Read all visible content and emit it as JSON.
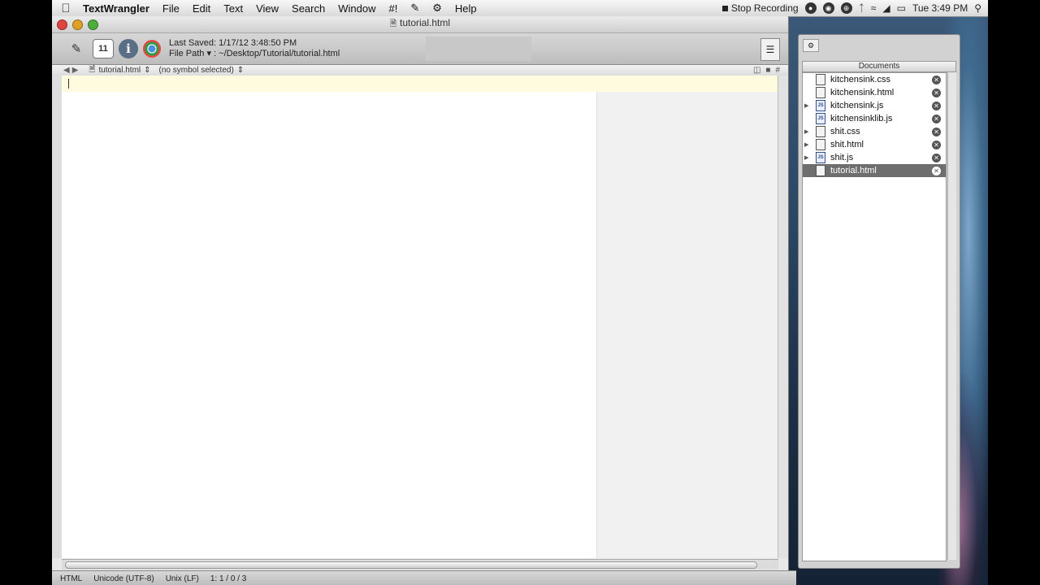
{
  "menubar": {
    "app_name": "TextWrangler",
    "items": [
      "File",
      "Edit",
      "Text",
      "View",
      "Search",
      "Window",
      "#!",
      "Help"
    ],
    "status_text": "Stop Recording",
    "clock": "Tue 3:49 PM"
  },
  "window": {
    "title": "tutorial.html",
    "toolbar": {
      "last_saved": "Last Saved: 1/17/12 3:48:50 PM",
      "file_path": "File Path ▾ : ~/Desktop/Tutorial/tutorial.html",
      "calendar_glyph": "11"
    },
    "navbar": {
      "file": "tutorial.html",
      "symbol": "(no symbol selected)"
    },
    "status": {
      "language": "HTML",
      "encoding": "Unicode (UTF-8)",
      "line_endings": "Unix (LF)",
      "position": "1: 1 / 0 / 3"
    }
  },
  "drawer": {
    "header": "Documents",
    "documents": [
      {
        "name": "kitchensink.css",
        "type": "css",
        "expandable": false,
        "selected": false
      },
      {
        "name": "kitchensink.html",
        "type": "html",
        "expandable": false,
        "selected": false
      },
      {
        "name": "kitchensink.js",
        "type": "js",
        "expandable": true,
        "selected": false
      },
      {
        "name": "kitchensinklib.js",
        "type": "js",
        "expandable": false,
        "selected": false
      },
      {
        "name": "shit.css",
        "type": "css",
        "expandable": true,
        "selected": false
      },
      {
        "name": "shit.html",
        "type": "html",
        "expandable": true,
        "selected": false
      },
      {
        "name": "shit.js",
        "type": "js",
        "expandable": true,
        "selected": false
      },
      {
        "name": "tutorial.html",
        "type": "html",
        "expandable": false,
        "selected": true
      }
    ]
  }
}
